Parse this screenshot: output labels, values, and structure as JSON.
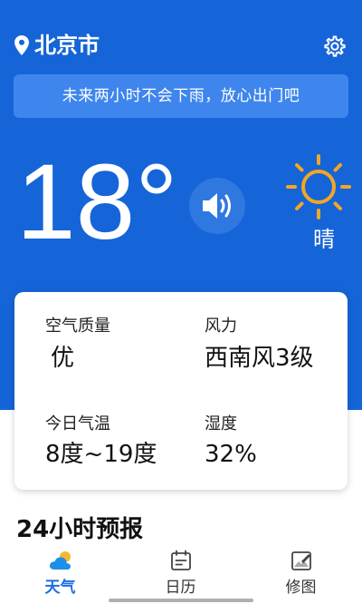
{
  "header": {
    "city": "北京市",
    "location_icon": "location-pin-icon",
    "settings_icon": "gear-icon"
  },
  "banner": {
    "text": "未来两小时不会下雨，放心出门吧"
  },
  "current": {
    "temperature": "18°",
    "condition": "晴",
    "condition_icon": "sun-icon",
    "voice_icon": "speaker-icon"
  },
  "details": {
    "air_quality_label": "空气质量",
    "air_quality_value": "优",
    "wind_label": "风力",
    "wind_value": "西南风3级",
    "temp_range_label": "今日气温",
    "temp_range_value": "8度~19度",
    "humidity_label": "湿度",
    "humidity_value": "32%"
  },
  "forecast": {
    "title": "24小时预报"
  },
  "tabs": [
    {
      "label": "天气",
      "icon": "weather-cloud-icon",
      "active": true
    },
    {
      "label": "日历",
      "icon": "calendar-icon",
      "active": false
    },
    {
      "label": "修图",
      "icon": "photo-edit-icon",
      "active": false
    }
  ],
  "colors": {
    "primary_blue": "#1565d8",
    "banner_blue": "#3e86ee",
    "sun_yellow": "#f5a623",
    "tab_active": "#1e6ee0",
    "tab_inactive": "#333333"
  }
}
